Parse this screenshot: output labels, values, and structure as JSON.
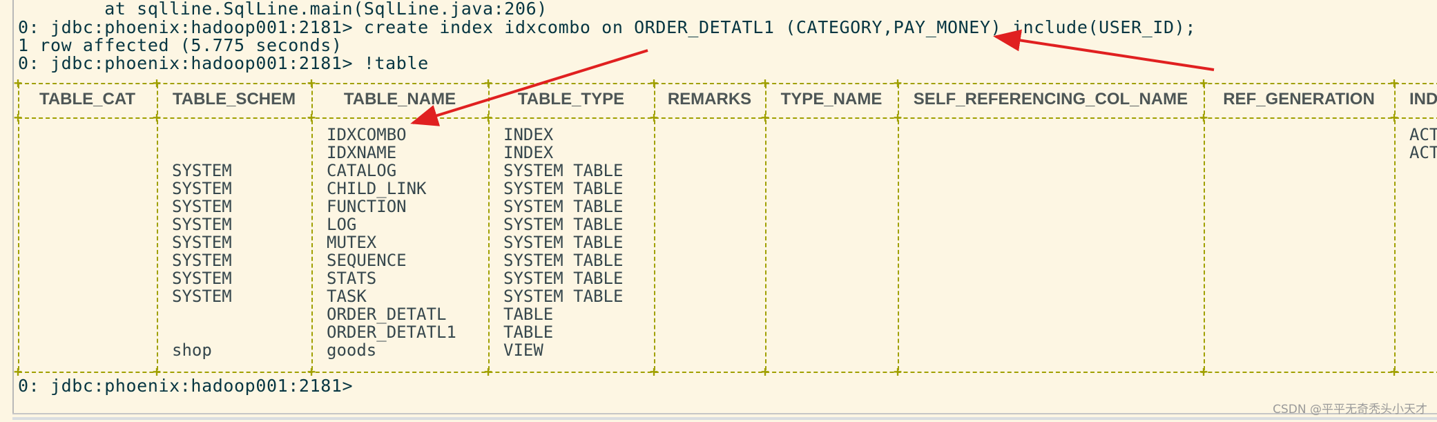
{
  "terminal": {
    "lines": [
      "        at sqlline.SqlLine.main(SqlLine.java:206)",
      "0: jdbc:phoenix:hadoop001:2181> create index idxcombo on ORDER_DETATL1 (CATEGORY,PAY_MONEY) include(USER_ID);",
      "1 row affected (5.775 seconds)",
      "0: jdbc:phoenix:hadoop001:2181> !table"
    ],
    "final_prompt": "0: jdbc:phoenix:hadoop001:2181>"
  },
  "table": {
    "columns": [
      "TABLE_CAT",
      "TABLE_SCHEM",
      "TABLE_NAME",
      "TABLE_TYPE",
      "REMARKS",
      "TYPE_NAME",
      "SELF_REFERENCING_COL_NAME",
      "REF_GENERATION",
      "IND"
    ],
    "rows": [
      {
        "cat": "",
        "schem": "",
        "name": "IDXCOMBO",
        "type": "INDEX",
        "ind": "ACT"
      },
      {
        "cat": "",
        "schem": "",
        "name": "IDXNAME",
        "type": "INDEX",
        "ind": "ACT"
      },
      {
        "cat": "",
        "schem": "SYSTEM",
        "name": "CATALOG",
        "type": "SYSTEM TABLE",
        "ind": ""
      },
      {
        "cat": "",
        "schem": "SYSTEM",
        "name": "CHILD_LINK",
        "type": "SYSTEM TABLE",
        "ind": ""
      },
      {
        "cat": "",
        "schem": "SYSTEM",
        "name": "FUNCTION",
        "type": "SYSTEM TABLE",
        "ind": ""
      },
      {
        "cat": "",
        "schem": "SYSTEM",
        "name": "LOG",
        "type": "SYSTEM TABLE",
        "ind": ""
      },
      {
        "cat": "",
        "schem": "SYSTEM",
        "name": "MUTEX",
        "type": "SYSTEM TABLE",
        "ind": ""
      },
      {
        "cat": "",
        "schem": "SYSTEM",
        "name": "SEQUENCE",
        "type": "SYSTEM TABLE",
        "ind": ""
      },
      {
        "cat": "",
        "schem": "SYSTEM",
        "name": "STATS",
        "type": "SYSTEM TABLE",
        "ind": ""
      },
      {
        "cat": "",
        "schem": "SYSTEM",
        "name": "TASK",
        "type": "SYSTEM TABLE",
        "ind": ""
      },
      {
        "cat": "",
        "schem": "",
        "name": "ORDER_DETATL",
        "type": "TABLE",
        "ind": ""
      },
      {
        "cat": "",
        "schem": "",
        "name": "ORDER_DETATL1",
        "type": "TABLE",
        "ind": ""
      },
      {
        "cat": "",
        "schem": "shop",
        "name": "goods",
        "type": "VIEW",
        "ind": ""
      }
    ]
  },
  "annotation_color": "#e02020",
  "watermark": "CSDN @平平无奇秃头小天才"
}
